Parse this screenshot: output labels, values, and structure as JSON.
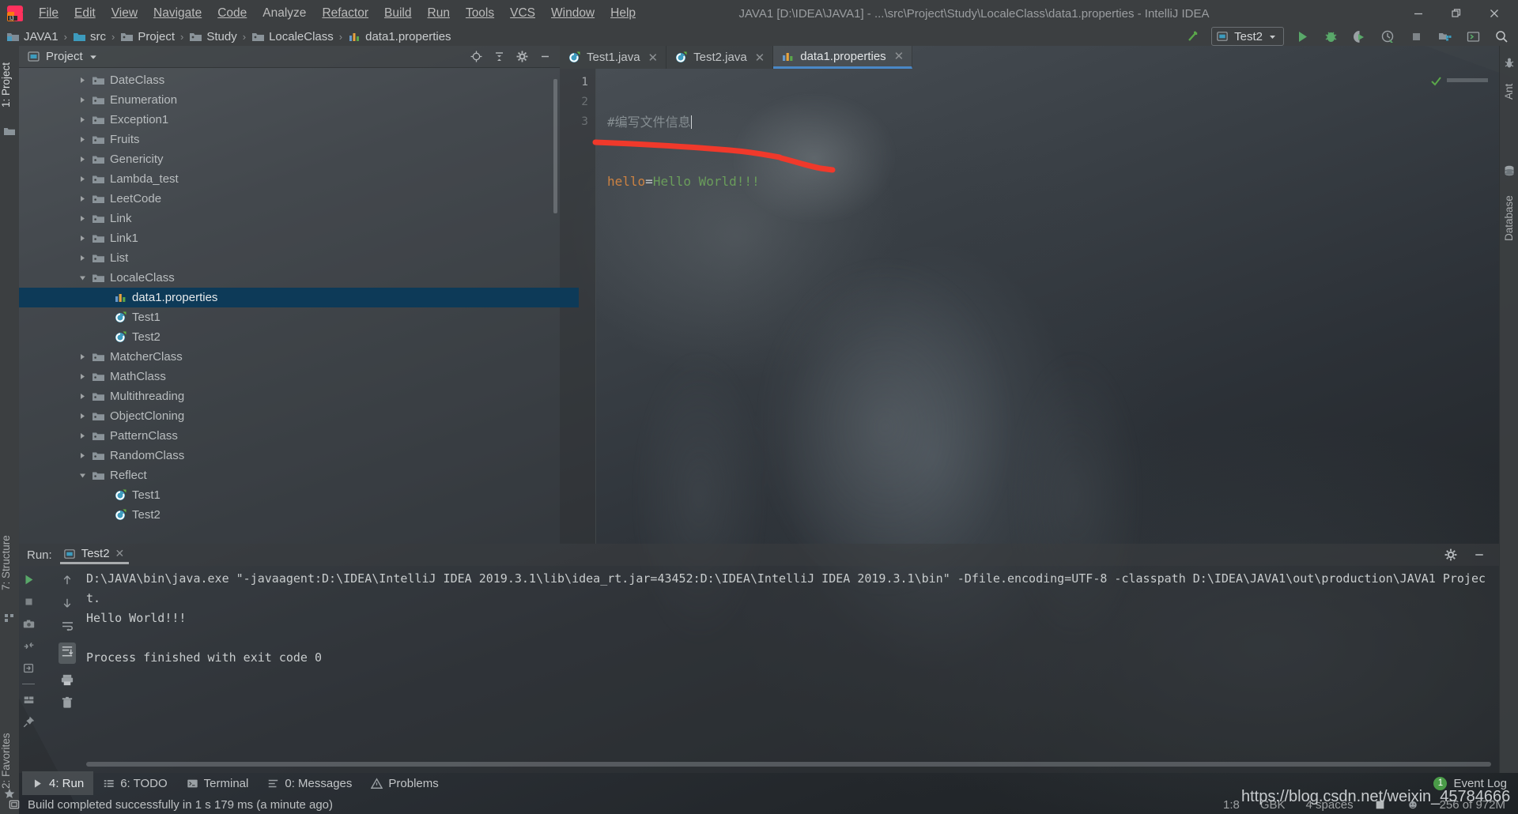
{
  "window": {
    "title": "JAVA1 [D:\\IDEA\\JAVA1] - ...\\src\\Project\\Study\\LocaleClass\\data1.properties - IntelliJ IDEA",
    "minimize_icon": "minimize-icon",
    "restore_icon": "restore-icon",
    "close_icon": "close-icon"
  },
  "menu": {
    "items": [
      "File",
      "Edit",
      "View",
      "Navigate",
      "Code",
      "Analyze",
      "Refactor",
      "Build",
      "Run",
      "Tools",
      "VCS",
      "Window",
      "Help"
    ]
  },
  "navbar": {
    "breadcrumbs": [
      {
        "label": "JAVA1",
        "icon": "project-module-icon"
      },
      {
        "label": "src",
        "icon": "source-folder-icon"
      },
      {
        "label": "Project",
        "icon": "folder-icon"
      },
      {
        "label": "Study",
        "icon": "folder-icon"
      },
      {
        "label": "LocaleClass",
        "icon": "folder-icon"
      },
      {
        "label": "data1.properties",
        "icon": "properties-file-icon"
      }
    ],
    "separator": "›",
    "run_config": "Test2",
    "toolbar_icons": [
      "build-icon",
      "run-icon",
      "debug-icon",
      "run-coverage-icon",
      "profiler-icon",
      "stop-icon",
      "project-structure-icon",
      "terminal-icon",
      "search-everywhere-icon"
    ]
  },
  "left_strip": {
    "project_label": "1: Project",
    "structure_label": "7: Structure",
    "favorites_label": "2: Favorites"
  },
  "right_strip": {
    "ant_label": "Ant",
    "database_label": "Database"
  },
  "project_panel": {
    "title": "Project",
    "header_icons": [
      "locate-icon",
      "collapse-all-icon",
      "gear-icon",
      "hide-icon"
    ],
    "tree": [
      {
        "label": "DateClass",
        "type": "folder",
        "depth": 1,
        "state": "collapsed",
        "selected": false
      },
      {
        "label": "Enumeration",
        "type": "folder",
        "depth": 1,
        "state": "collapsed",
        "selected": false
      },
      {
        "label": "Exception1",
        "type": "folder",
        "depth": 1,
        "state": "collapsed",
        "selected": false
      },
      {
        "label": "Fruits",
        "type": "folder",
        "depth": 1,
        "state": "collapsed",
        "selected": false
      },
      {
        "label": "Genericity",
        "type": "folder",
        "depth": 1,
        "state": "collapsed",
        "selected": false
      },
      {
        "label": "Lambda_test",
        "type": "folder",
        "depth": 1,
        "state": "collapsed",
        "selected": false
      },
      {
        "label": "LeetCode",
        "type": "folder",
        "depth": 1,
        "state": "collapsed",
        "selected": false
      },
      {
        "label": "Link",
        "type": "folder",
        "depth": 1,
        "state": "collapsed",
        "selected": false
      },
      {
        "label": "Link1",
        "type": "folder",
        "depth": 1,
        "state": "collapsed",
        "selected": false
      },
      {
        "label": "List",
        "type": "folder",
        "depth": 1,
        "state": "collapsed",
        "selected": false
      },
      {
        "label": "LocaleClass",
        "type": "folder",
        "depth": 1,
        "state": "expanded",
        "selected": false
      },
      {
        "label": "data1.properties",
        "type": "properties",
        "depth": 2,
        "state": "leaf",
        "selected": true
      },
      {
        "label": "Test1",
        "type": "class",
        "depth": 2,
        "state": "leaf",
        "selected": false
      },
      {
        "label": "Test2",
        "type": "class",
        "depth": 2,
        "state": "leaf",
        "selected": false
      },
      {
        "label": "MatcherClass",
        "type": "folder",
        "depth": 1,
        "state": "collapsed",
        "selected": false
      },
      {
        "label": "MathClass",
        "type": "folder",
        "depth": 1,
        "state": "collapsed",
        "selected": false
      },
      {
        "label": "Multithreading",
        "type": "folder",
        "depth": 1,
        "state": "collapsed",
        "selected": false
      },
      {
        "label": "ObjectCloning",
        "type": "folder",
        "depth": 1,
        "state": "collapsed",
        "selected": false
      },
      {
        "label": "PatternClass",
        "type": "folder",
        "depth": 1,
        "state": "collapsed",
        "selected": false
      },
      {
        "label": "RandomClass",
        "type": "folder",
        "depth": 1,
        "state": "collapsed",
        "selected": false
      },
      {
        "label": "Reflect",
        "type": "folder",
        "depth": 1,
        "state": "expanded",
        "selected": false
      },
      {
        "label": "Test1",
        "type": "class",
        "depth": 2,
        "state": "leaf",
        "selected": false
      },
      {
        "label": "Test2",
        "type": "class",
        "depth": 2,
        "state": "leaf",
        "selected": false
      }
    ]
  },
  "editor": {
    "tabs": [
      {
        "label": "Test1.java",
        "icon": "java-class-icon",
        "active": false
      },
      {
        "label": "Test2.java",
        "icon": "java-class-icon",
        "active": false
      },
      {
        "label": "data1.properties",
        "icon": "properties-file-icon",
        "active": true
      }
    ],
    "close_glyph": "✕",
    "line_numbers": [
      "1",
      "2",
      "3"
    ],
    "lines": [
      {
        "n": "1",
        "comment": "#编写文件信息",
        "caret": true
      },
      {
        "n": "2",
        "key": "hello",
        "eq": "=",
        "value": "Hello World!!!"
      },
      {
        "n": "3"
      }
    ],
    "inspection_status": "ok-check-icon",
    "colors": {
      "comment": "#868e92",
      "key": "#cc8242",
      "value": "#6a9d5b",
      "tab_underline": "#4a88c7",
      "selection": "#0d3a58"
    }
  },
  "run_panel": {
    "label": "Run:",
    "tab_label": "Test2",
    "close_glyph": "✕",
    "toolbar_icons": [
      "rerun-icon",
      "stop-icon",
      "screenshot-icon",
      "restore-layout-icon",
      "export-icon",
      "layout-icon",
      "pin-icon"
    ],
    "toolbar_icons_2": [
      "scroll-up-icon",
      "scroll-down-icon",
      "soft-wrap-icon",
      "scroll-to-end-icon",
      "print-icon",
      "trash-icon"
    ],
    "header_icons": [
      "gear-icon",
      "hide-icon"
    ],
    "console_lines": [
      "D:\\JAVA\\bin\\java.exe \"-javaagent:D:\\IDEA\\IntelliJ IDEA 2019.3.1\\lib\\idea_rt.jar=43452:D:\\IDEA\\IntelliJ IDEA 2019.3.1\\bin\" -Dfile.encoding=UTF-8 -classpath D:\\IDEA\\JAVA1\\out\\production\\JAVA1 Project.",
      "Hello World!!!",
      "",
      "Process finished with exit code 0"
    ]
  },
  "bottom_bar": {
    "buttons": [
      {
        "label": "4: Run",
        "mnemonic": "4",
        "icon": "run-icon",
        "active": true
      },
      {
        "label": "6: TODO",
        "mnemonic": "6",
        "icon": "todo-icon",
        "active": false
      },
      {
        "label": "Terminal",
        "mnemonic": "",
        "icon": "terminal-icon",
        "active": false
      },
      {
        "label": "0: Messages",
        "mnemonic": "0",
        "icon": "messages-icon",
        "active": false
      },
      {
        "label": "Problems",
        "mnemonic": "",
        "icon": "problems-icon",
        "active": false
      }
    ],
    "event_log_label": "Event Log",
    "event_log_count": "1"
  },
  "status_bar": {
    "message": "Build completed successfully in 1 s 179 ms (a minute ago)",
    "caret_position": "1:8",
    "encoding": "GBK",
    "indent": "4 spaces",
    "line_separator": "line-separator-icon",
    "memory": "256 of 972M"
  },
  "watermark": {
    "text": "https://blog.csdn.net/weixin_45784666"
  }
}
